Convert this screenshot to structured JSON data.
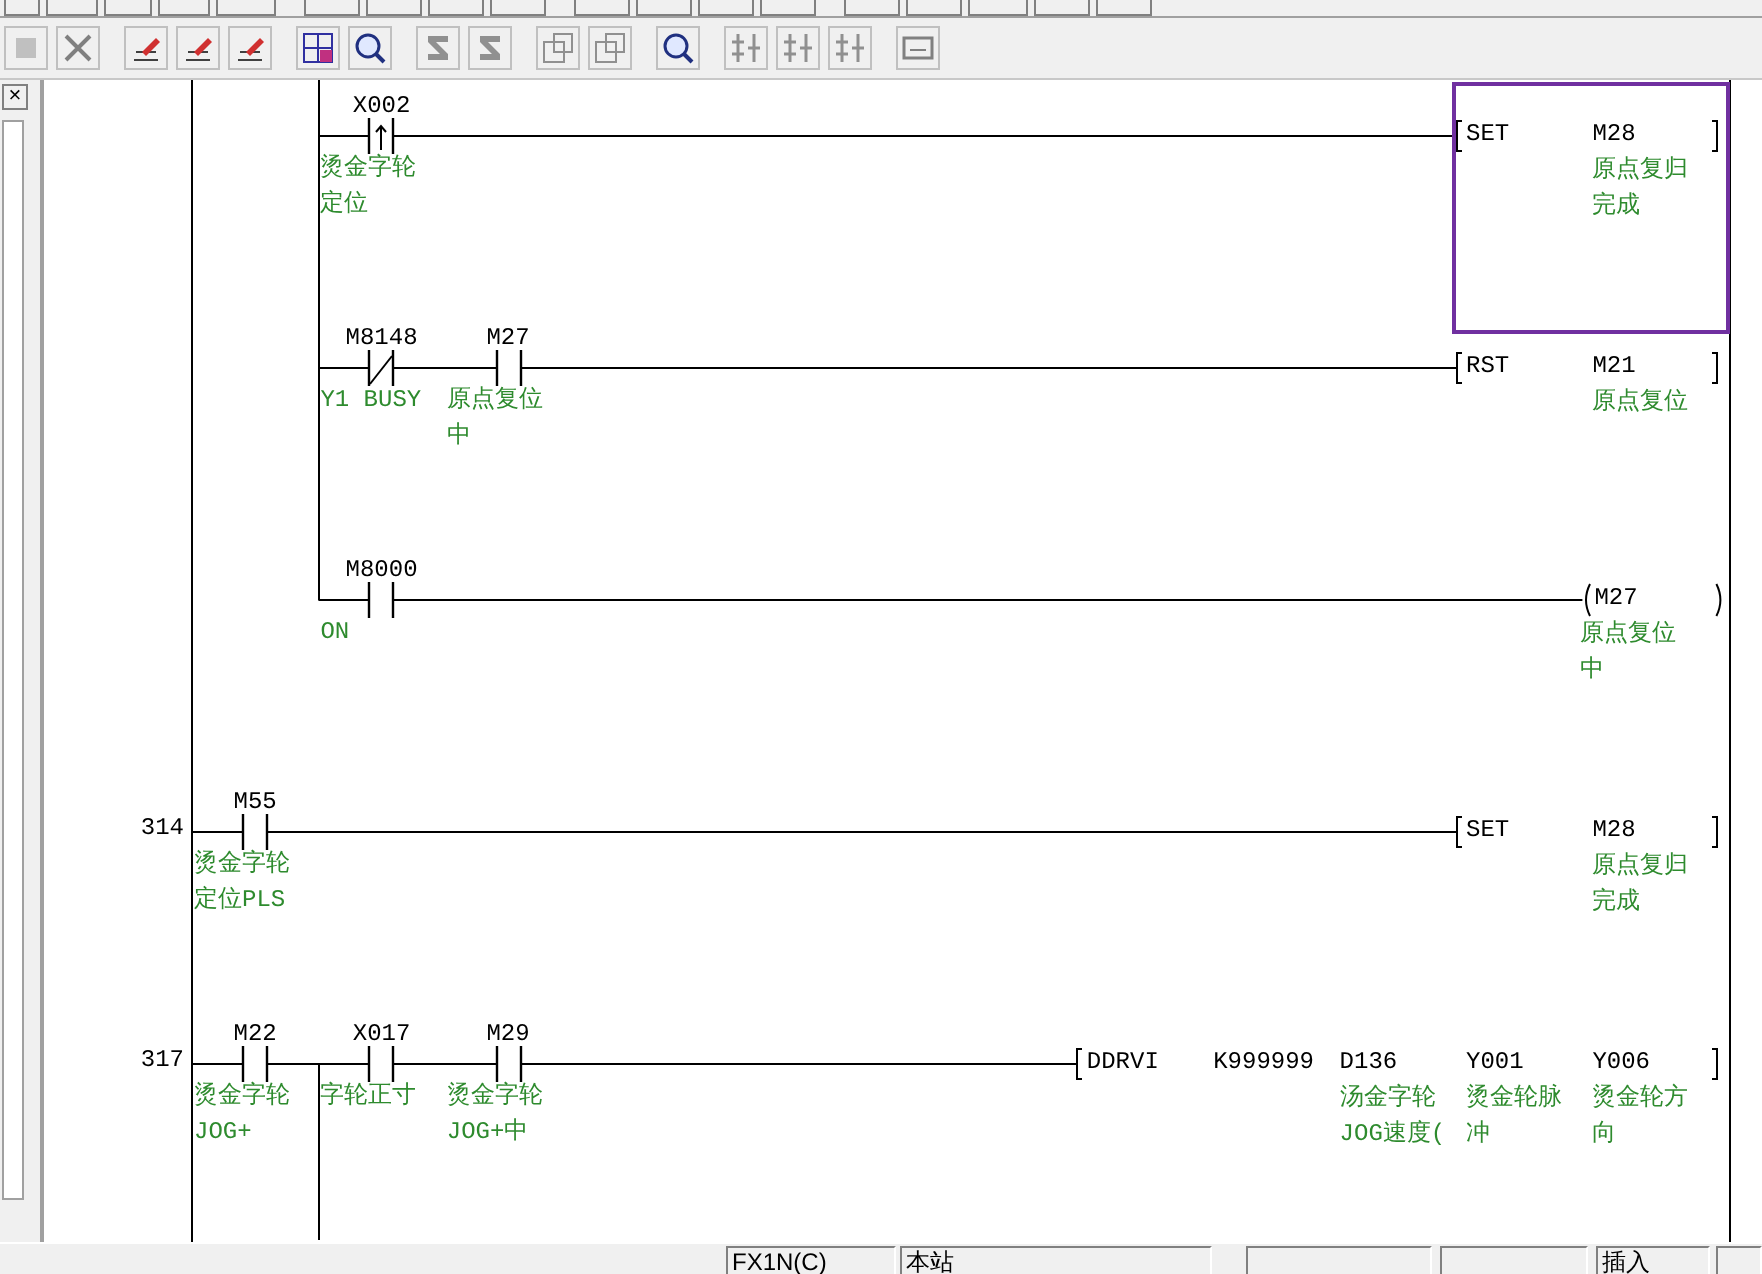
{
  "left_panel": {
    "close": "×"
  },
  "ladder": {
    "rungs": [
      {
        "rows": [
          {
            "contacts": [
              {
                "kind": "rising",
                "device": "X002",
                "comment": "烫金字轮定位",
                "joins_above": true,
                "joins_below": true
              }
            ],
            "output": {
              "kind": "instruction",
              "selected": true,
              "parts": [
                {
                  "text": "SET"
                },
                {
                  "text": "M28",
                  "comment": "原点复归完成"
                }
              ]
            }
          },
          {
            "contacts": [
              {
                "kind": "nc",
                "device": "M8148",
                "comment": "Y1 BUSY",
                "joins_above": true,
                "joins_below": true
              },
              {
                "kind": "no",
                "device": "M27",
                "comment": "原点复位中"
              }
            ],
            "output": {
              "kind": "instruction",
              "selected": false,
              "parts": [
                {
                  "text": "RST"
                },
                {
                  "text": "M21",
                  "comment": "原点复位"
                }
              ]
            }
          },
          {
            "contacts": [
              {
                "kind": "no",
                "device": "M8000",
                "comment": "ON",
                "joins_above": true,
                "joins_below": false
              }
            ],
            "output": {
              "kind": "coil",
              "selected": false,
              "device": "M27",
              "comment": "原点复位中"
            }
          }
        ]
      },
      {
        "step": "314",
        "rows": [
          {
            "contacts": [
              {
                "kind": "no",
                "device": "M55",
                "comment": "烫金字轮定位PLS"
              }
            ],
            "output": {
              "kind": "instruction",
              "selected": false,
              "parts": [
                {
                  "text": "SET"
                },
                {
                  "text": "M28",
                  "comment": "原点复归完成"
                }
              ]
            }
          }
        ]
      },
      {
        "step": "317",
        "rows": [
          {
            "contacts": [
              {
                "kind": "no",
                "device": "M22",
                "comment": "烫金字轮JOG+"
              },
              {
                "kind": "no",
                "device": "X017",
                "comment": "字轮正寸",
                "joins_above": false,
                "joins_below": true
              },
              {
                "kind": "no",
                "device": "M29",
                "comment": "烫金字轮JOG+中"
              }
            ],
            "output": {
              "kind": "instruction",
              "selected": false,
              "parts": [
                {
                  "text": "DDRVI"
                },
                {
                  "text": "K999999"
                },
                {
                  "text": "D136",
                  "comment": "汤金字轮JOG速度("
                },
                {
                  "text": "Y001",
                  "comment": "烫金轮脉冲"
                },
                {
                  "text": "Y006",
                  "comment": "烫金轮方向"
                }
              ]
            }
          }
        ]
      }
    ]
  },
  "status_bar": {
    "plc_type": "FX1N(C)",
    "station": "本站",
    "mode": "插入"
  }
}
